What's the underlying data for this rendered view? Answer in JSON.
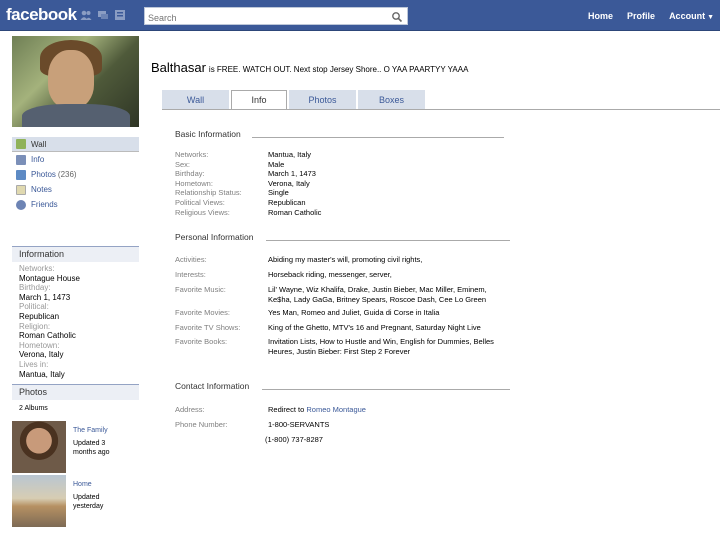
{
  "topbar": {
    "logo": "facebook",
    "search_placeholder": "Search",
    "nav": {
      "home": "Home",
      "profile": "Profile",
      "account": "Account"
    }
  },
  "profile": {
    "name": "Balthasar",
    "status": "is FREE. WATCH OUT. Next stop Jersey Shore.. O YAA PAARTYY YAAA"
  },
  "tabs": [
    "Wall",
    "Info",
    "Photos",
    "Boxes"
  ],
  "left_nav": [
    {
      "label": "Wall",
      "icon": "wall-icon",
      "count": ""
    },
    {
      "label": "Info",
      "icon": "info-icon",
      "count": ""
    },
    {
      "label": "Photos",
      "icon": "photos-icon",
      "count": "(236)"
    },
    {
      "label": "Notes",
      "icon": "notes-icon",
      "count": ""
    },
    {
      "label": "Friends",
      "icon": "friends-icon",
      "count": ""
    }
  ],
  "info_box": {
    "title": "Information",
    "items": [
      {
        "label": "Networks:",
        "value": "Montague House"
      },
      {
        "label": "Birthday:",
        "value": "March 1, 1473"
      },
      {
        "label": "Political:",
        "value": "Republican"
      },
      {
        "label": "Religion:",
        "value": "Roman Catholic"
      },
      {
        "label": "Hometown:",
        "value": "Verona, Italy"
      },
      {
        "label": "Lives in:",
        "value": "Mantua, Italy"
      }
    ]
  },
  "photos_box": {
    "title": "Photos",
    "albums_count": "2 Albums",
    "albums": [
      {
        "title": "The Family",
        "updated": "Updated 3 months ago"
      },
      {
        "title": "Home",
        "updated": "Updated yesterday"
      }
    ]
  },
  "basic": {
    "title": "Basic Information",
    "rows": [
      {
        "label": "Networks:",
        "value": "Mantua, Italy"
      },
      {
        "label": "Sex:",
        "value": "Male"
      },
      {
        "label": "Birthday:",
        "value": "March 1, 1473"
      },
      {
        "label": "Hometown:",
        "value": "Verona, Italy"
      },
      {
        "label": "Relationship Status:",
        "value": "Single"
      },
      {
        "label": "Political Views:",
        "value": "Republican"
      },
      {
        "label": "Religious Views:",
        "value": "Roman Catholic"
      }
    ]
  },
  "personal": {
    "title": "Personal Information",
    "rows": [
      {
        "label": "Activities:",
        "line1": "Abiding my master's will, promoting civil rights,",
        "line2": ""
      },
      {
        "label": "Interests:",
        "line1": "Horseback riding, messenger, server,",
        "line2": ""
      },
      {
        "label": "Favorite Music:",
        "line1": "Lil' Wayne, Wiz Khalifa, Drake, Justin Bieber, Mac Miller, Eminem,",
        "line2": "Ke$ha, Lady GaGa, Britney Spears, Roscoe Dash, Cee Lo Green"
      },
      {
        "label": "Favorite Movies:",
        "line1": "Yes Man, Romeo and Juliet, Guida di Corse  in Italia",
        "line2": ""
      },
      {
        "label": "Favorite TV Shows:",
        "line1": "King of the Ghetto, MTV's 16 and Pregnant, Saturday Night Live",
        "line2": ""
      },
      {
        "label": "Favorite Books:",
        "line1": "Invitation Lists,  How to Hustle and Win, English for Dummies, Belles",
        "line2": "Heures, Justin Bieber: First Step 2 Forever"
      }
    ]
  },
  "contact": {
    "title": "Contact Information",
    "address_label": "Address:",
    "address_prefix": "Redirect to ",
    "address_link": "Romeo Montague",
    "phone_label": "Phone Number:",
    "phone1": "1-800-SERVANTS",
    "phone2": "(1-800) 737-8287"
  },
  "colors": {
    "brand": "#3b5998",
    "tab_bg": "#d8dfea",
    "box_head": "#eceff5"
  }
}
